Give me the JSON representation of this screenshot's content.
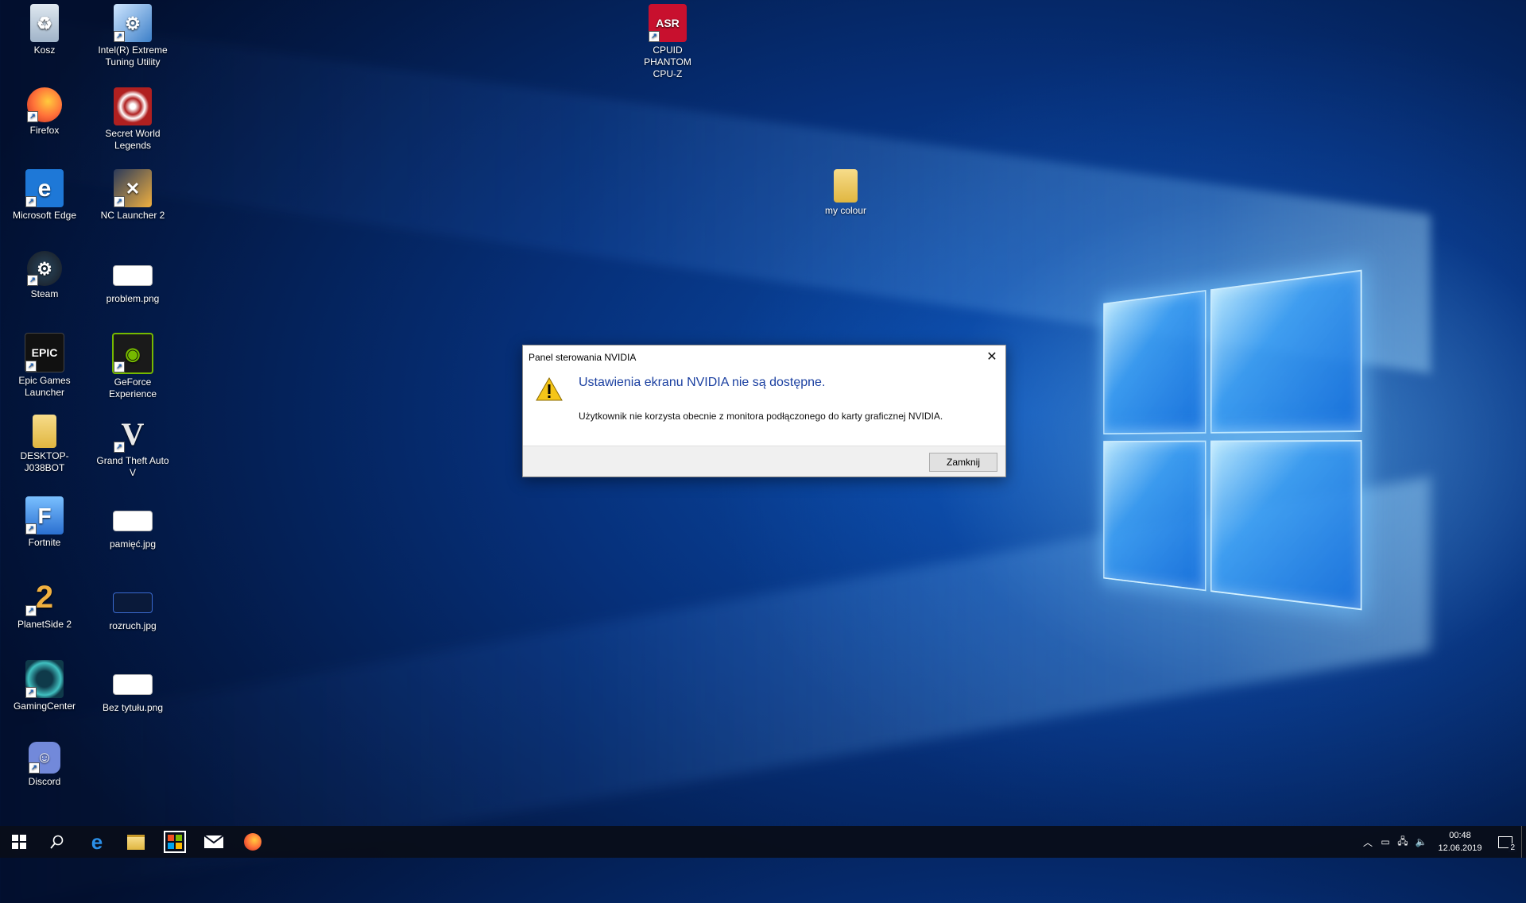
{
  "desktop": {
    "icons": [
      {
        "label": "Kosz",
        "icon": "recycle-bin-icon",
        "color": "#9fb3c8"
      },
      {
        "label": "Intel(R) Extreme\nTuning Utility",
        "icon": "intel-xtu-icon",
        "color": "#5a9fd8"
      },
      {
        "label": "CPUID PHANTOM\nCPU-Z",
        "icon": "cpuz-icon",
        "color": "#c8102e"
      },
      {
        "label": "Firefox",
        "icon": "firefox-icon",
        "color": "#ff7139"
      },
      {
        "label": "Secret World\nLegends",
        "icon": "secret-world-icon",
        "color": "#a02020"
      },
      {
        "label": "Microsoft Edge",
        "icon": "edge-icon",
        "color": "#1e78d7"
      },
      {
        "label": "NC Launcher 2",
        "icon": "nc-launcher-icon",
        "color": "#3a4a6a"
      },
      {
        "label": "my colour",
        "icon": "folder-icon",
        "color": "#e8c15a"
      },
      {
        "label": "Steam",
        "icon": "steam-icon",
        "color": "#1b2838"
      },
      {
        "label": "problem.png",
        "icon": "image-file-icon",
        "color": "#ffffff"
      },
      {
        "label": "Epic Games\nLauncher",
        "icon": "epic-games-icon",
        "color": "#111111"
      },
      {
        "label": "GeForce Experience",
        "icon": "geforce-icon",
        "color": "#76b900"
      },
      {
        "label": "DESKTOP-J038BOT",
        "icon": "folder-icon",
        "color": "#e8c15a"
      },
      {
        "label": "Grand Theft Auto V",
        "icon": "gta-icon",
        "color": "#2a2a2a"
      },
      {
        "label": "Fortnite",
        "icon": "fortnite-icon",
        "color": "#3c8fe0"
      },
      {
        "label": "pamięć.jpg",
        "icon": "image-file-icon",
        "color": "#ffffff"
      },
      {
        "label": "PlanetSide 2",
        "icon": "planetside-icon",
        "color": "#e0a030"
      },
      {
        "label": "rozruch.jpg",
        "icon": "image-file-icon",
        "color": "#ffffff"
      },
      {
        "label": "GamingCenter",
        "icon": "gaming-center-icon",
        "color": "#2aa0a0"
      },
      {
        "label": "Bez tytułu.png",
        "icon": "image-file-icon",
        "color": "#ffffff"
      },
      {
        "label": "Discord",
        "icon": "discord-icon",
        "color": "#7289da"
      }
    ]
  },
  "dialog": {
    "title": "Panel sterowania NVIDIA",
    "heading": "Ustawienia ekranu NVIDIA nie są dostępne.",
    "message": "Użytkownik nie korzysta obecnie z monitora podłączonego do karty graficznej NVIDIA.",
    "close_glyph": "✕",
    "button_label": "Zamknij"
  },
  "taskbar": {
    "time": "00:48",
    "date": "12.06.2019",
    "notification_count": "2"
  }
}
